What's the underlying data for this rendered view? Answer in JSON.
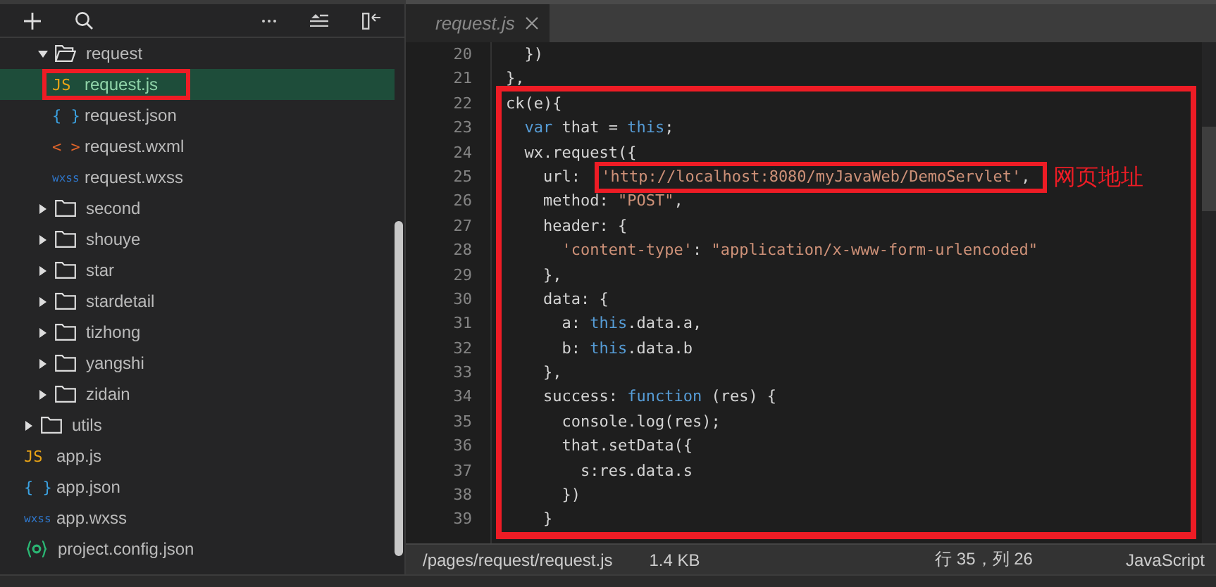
{
  "sidebar": {
    "tree": {
      "scrolled_folder_children": [
        {
          "label": "request",
          "kind": "folder",
          "expanded": true,
          "selected": false,
          "children": [
            {
              "label": "request.js",
              "kind": "file",
              "color": "#e8a317",
              "icon": "JS",
              "selected": true,
              "annotated": true
            },
            {
              "label": "request.json",
              "kind": "file",
              "color": "#3ba1e0",
              "icon": "{ }",
              "selected": false,
              "annotated": false
            },
            {
              "label": "request.wxml",
              "kind": "file",
              "color": "#e0642a",
              "icon": "< >",
              "selected": false,
              "annotated": false
            },
            {
              "label": "request.wxss",
              "kind": "file",
              "color": "#2f76c9",
              "icon": "wxss",
              "selected": false,
              "annotated": false
            }
          ]
        },
        {
          "label": "second",
          "kind": "folder",
          "expanded": false,
          "selected": false
        },
        {
          "label": "shouye",
          "kind": "folder",
          "expanded": false,
          "selected": false
        },
        {
          "label": "star",
          "kind": "folder",
          "expanded": false,
          "selected": false
        },
        {
          "label": "stardetail",
          "kind": "folder",
          "expanded": false,
          "selected": false
        },
        {
          "label": "tizhong",
          "kind": "folder",
          "expanded": false,
          "selected": false
        },
        {
          "label": "yangshi",
          "kind": "folder",
          "expanded": false,
          "selected": false
        },
        {
          "label": "zidain",
          "kind": "folder",
          "expanded": false,
          "selected": false
        }
      ],
      "root_items": [
        {
          "label": "utils",
          "kind": "folder",
          "expanded": false,
          "selected": false
        },
        {
          "label": "app.js",
          "kind": "file",
          "color": "#e8a317",
          "icon": "JS",
          "selected": false,
          "annotated": false
        },
        {
          "label": "app.json",
          "kind": "file",
          "color": "#3ba1e0",
          "icon": "{ }",
          "selected": false,
          "annotated": false
        },
        {
          "label": "app.wxss",
          "kind": "file",
          "color": "#2f76c9",
          "icon": "wxss",
          "selected": false,
          "annotated": false
        },
        {
          "label": "project.config.json",
          "kind": "config_file",
          "color": "#2bb673",
          "selected": false,
          "annotated": false
        }
      ]
    }
  },
  "editor": {
    "tabs": [
      {
        "label": "request.js",
        "selected": true
      }
    ],
    "lines_before": [
      {
        "number": "20",
        "tokens": [
          {
            "text": "  })",
            "kind": "plain"
          }
        ]
      },
      {
        "number": "21",
        "tokens": [
          {
            "text": "},",
            "kind": "plain"
          }
        ]
      }
    ],
    "annotated_block": {
      "lines": [
        {
          "number": "22",
          "tokens": [
            {
              "text": "ck(e){",
              "kind": "plain"
            }
          ]
        },
        {
          "number": "23",
          "tokens": [
            {
              "text": "  var",
              "kind": "keyword"
            },
            {
              "text": " that = ",
              "kind": "plain"
            },
            {
              "text": "this",
              "kind": "keyword"
            },
            {
              "text": ";",
              "kind": "plain"
            }
          ]
        },
        {
          "number": "24",
          "tokens": [
            {
              "text": "  wx.request({",
              "kind": "plain"
            }
          ]
        },
        {
          "number": "25",
          "tokens": [
            {
              "text": "    url: ",
              "kind": "plain"
            },
            {
              "text": "'http://localhost:8080/myJavaWeb/DemoServlet'",
              "kind": "string",
              "annotated": true
            },
            {
              "text": ",",
              "kind": "plain",
              "annotated": true
            }
          ],
          "note": "网页地址"
        },
        {
          "number": "26",
          "tokens": [
            {
              "text": "    method: ",
              "kind": "plain"
            },
            {
              "text": "\"POST\"",
              "kind": "string"
            },
            {
              "text": ",",
              "kind": "plain"
            }
          ]
        },
        {
          "number": "27",
          "tokens": [
            {
              "text": "    header: {",
              "kind": "plain"
            }
          ]
        },
        {
          "number": "28",
          "tokens": [
            {
              "text": "      'content-type'",
              "kind": "string"
            },
            {
              "text": ": ",
              "kind": "plain"
            },
            {
              "text": "\"application/x-www-form-urlencoded\"",
              "kind": "string"
            }
          ]
        },
        {
          "number": "29",
          "tokens": [
            {
              "text": "    },",
              "kind": "plain"
            }
          ]
        },
        {
          "number": "30",
          "tokens": [
            {
              "text": "    data: {",
              "kind": "plain"
            }
          ]
        },
        {
          "number": "31",
          "tokens": [
            {
              "text": "      a: ",
              "kind": "plain"
            },
            {
              "text": "this",
              "kind": "keyword"
            },
            {
              "text": ".data.a,",
              "kind": "plain"
            }
          ]
        },
        {
          "number": "32",
          "tokens": [
            {
              "text": "      b: ",
              "kind": "plain"
            },
            {
              "text": "this",
              "kind": "keyword"
            },
            {
              "text": ".data.b",
              "kind": "plain"
            }
          ]
        },
        {
          "number": "33",
          "tokens": [
            {
              "text": "    },",
              "kind": "plain"
            }
          ]
        },
        {
          "number": "34",
          "tokens": [
            {
              "text": "    success: ",
              "kind": "plain"
            },
            {
              "text": "function",
              "kind": "keyword"
            },
            {
              "text": " (res) {",
              "kind": "plain"
            }
          ]
        },
        {
          "number": "35",
          "tokens": [
            {
              "text": "      console.log(res);",
              "kind": "plain"
            }
          ]
        },
        {
          "number": "36",
          "tokens": [
            {
              "text": "      that.setData({",
              "kind": "plain"
            }
          ]
        },
        {
          "number": "37",
          "tokens": [
            {
              "text": "        s:res.data.s",
              "kind": "plain"
            }
          ]
        },
        {
          "number": "38",
          "tokens": [
            {
              "text": "      })",
              "kind": "plain"
            }
          ]
        },
        {
          "number": "39",
          "tokens": [
            {
              "text": "    }",
              "kind": "plain"
            }
          ]
        }
      ]
    }
  },
  "status_bar": {
    "path": "/pages/request/request.js",
    "size": "1.4 KB",
    "cursor": "行 35，列 26",
    "language": "JavaScript"
  }
}
